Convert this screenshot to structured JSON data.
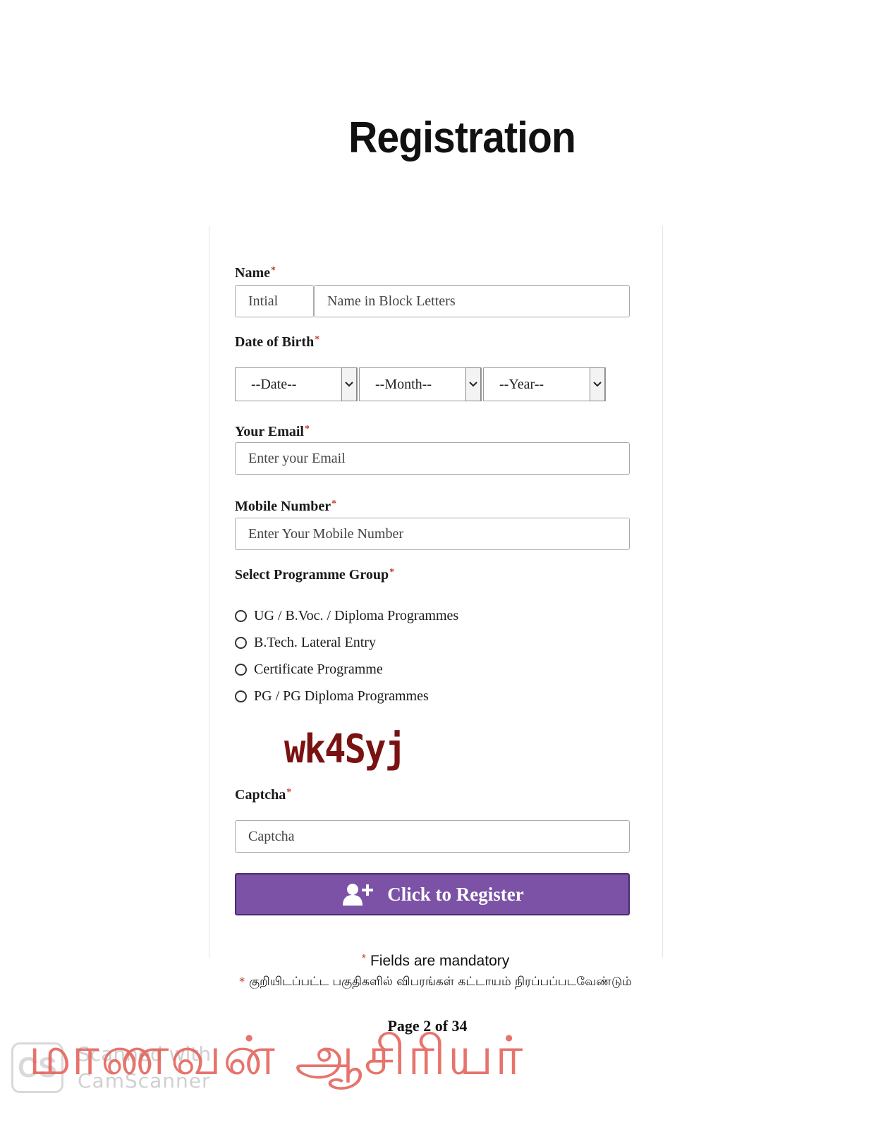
{
  "page_title": "Registration",
  "form": {
    "name_label": "Name",
    "initial_placeholder": "Intial",
    "name_placeholder": "Name in Block Letters",
    "dob_label": "Date of Birth",
    "dob_date": "--Date--",
    "dob_month": "--Month--",
    "dob_year": "--Year--",
    "email_label": "Your Email",
    "email_placeholder": "Enter your Email",
    "mobile_label": "Mobile Number",
    "mobile_placeholder": "Enter Your Mobile Number",
    "programme_label": "Select Programme Group",
    "programmes": [
      "UG / B.Voc. / Diploma Programmes",
      "B.Tech. Lateral Entry",
      "Certificate Programme",
      "PG / PG Diploma Programmes"
    ],
    "captcha_image_text": "wk4Syj",
    "captcha_label": "Captcha",
    "captcha_placeholder": "Captcha",
    "register_button": "Click to Register",
    "required_mark": "*"
  },
  "footer": {
    "mandatory_note": "Fields are mandatory",
    "mandatory_note_tamil": "குறியிடப்பட்ட பகுதிகளில் விபரங்கள் கட்டாயம் நிரப்பப்படவேண்டும்",
    "page_number": "Page 2 of 34"
  },
  "watermark": {
    "logo": "CS",
    "scanned_with": "Scanned with",
    "app_name": "CamScanner",
    "tamil_overlay": "மாணவன் ஆசிரியர்"
  },
  "colors": {
    "button_bg": "#7b52a6",
    "required": "#c0392b",
    "captcha": "#7a1212",
    "tamil_overlay": "#e25c54"
  }
}
